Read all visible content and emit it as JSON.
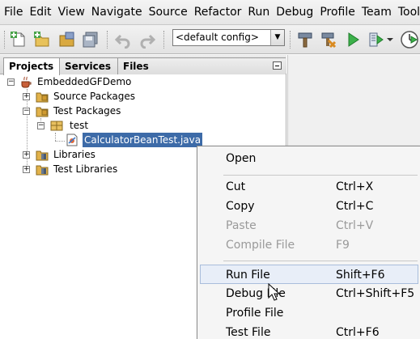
{
  "menubar": {
    "items": [
      "File",
      "Edit",
      "View",
      "Navigate",
      "Source",
      "Refactor",
      "Run",
      "Debug",
      "Profile",
      "Team",
      "Tools"
    ]
  },
  "toolbar": {
    "config_value": "<default config>",
    "icons": [
      "new-file-icon",
      "new-project-icon",
      "open-project-icon",
      "save-all-icon",
      "undo-icon",
      "redo-icon",
      "build-icon",
      "clean-build-icon",
      "run-icon",
      "debug-icon",
      "profile-icon"
    ]
  },
  "left_pane": {
    "tabs": [
      {
        "label": "Projects",
        "close": "✕",
        "active": true
      },
      {
        "label": "Services",
        "active": false
      },
      {
        "label": "Files",
        "active": false
      }
    ],
    "tree": {
      "root": "EmbeddedGFDemo",
      "source_packages": "Source Packages",
      "test_packages": "Test Packages",
      "test_pkg": "test",
      "test_file": "CalculatorBeanTest.java",
      "libraries": "Libraries",
      "test_libraries": "Test Libraries"
    }
  },
  "context_menu": {
    "items": [
      {
        "label": "Open",
        "shortcut": "",
        "enabled": true
      },
      {
        "label": "Cut",
        "shortcut": "Ctrl+X",
        "enabled": true
      },
      {
        "label": "Copy",
        "shortcut": "Ctrl+C",
        "enabled": true
      },
      {
        "label": "Paste",
        "shortcut": "Ctrl+V",
        "enabled": false
      },
      {
        "label": "Compile File",
        "shortcut": "F9",
        "enabled": false
      },
      {
        "label": "Run File",
        "shortcut": "Shift+F6",
        "enabled": true,
        "highlighted": true
      },
      {
        "label": "Debug File",
        "shortcut": "Ctrl+Shift+F5",
        "enabled": true
      },
      {
        "label": "Profile File",
        "shortcut": "",
        "enabled": true
      },
      {
        "label": "Test File",
        "shortcut": "Ctrl+F6",
        "enabled": true
      }
    ]
  },
  "colors": {
    "selection": "#3d6ba8",
    "menu_highlight": "#e8eef8",
    "disabled_text": "#9a9a9a"
  }
}
